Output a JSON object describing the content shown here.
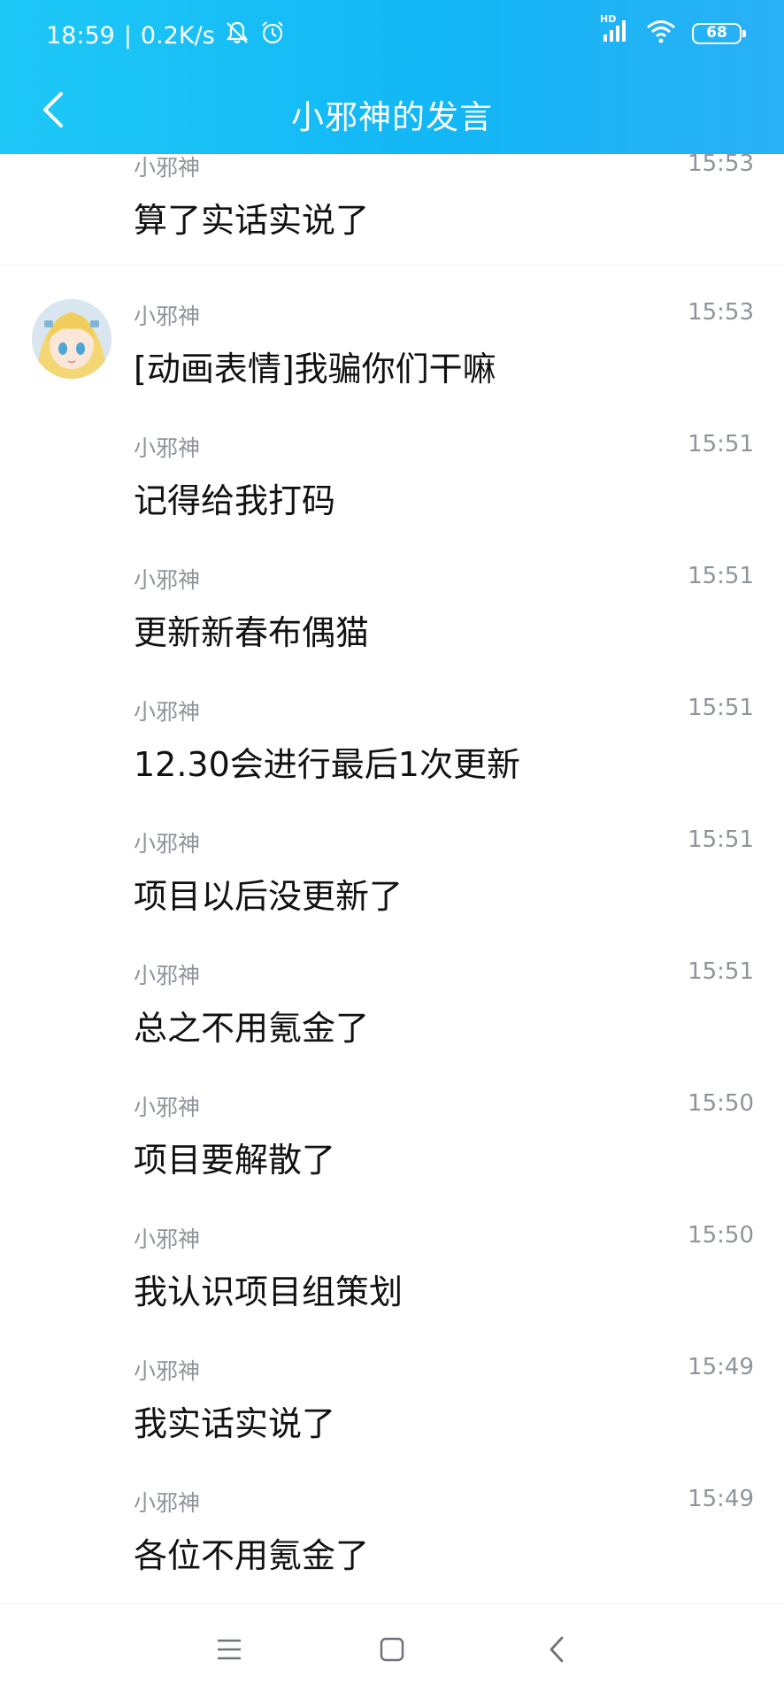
{
  "status_bar": {
    "time": "18:59",
    "separator": "|",
    "net_speed": "0.2K/s",
    "hd_label": "HD",
    "battery_level": "68"
  },
  "header": {
    "title": "小邪神的发言"
  },
  "messages": [
    {
      "sender": "小邪神",
      "time": "15:53",
      "text": "算了实话实说了"
    },
    {
      "sender": "小邪神",
      "time": "15:53",
      "text": "[动画表情]我骗你们干嘛"
    },
    {
      "sender": "小邪神",
      "time": "15:51",
      "text": "记得给我打码"
    },
    {
      "sender": "小邪神",
      "time": "15:51",
      "text": "更新新春布偶猫"
    },
    {
      "sender": "小邪神",
      "time": "15:51",
      "text": "12.30会进行最后1次更新"
    },
    {
      "sender": "小邪神",
      "time": "15:51",
      "text": "项目以后没更新了"
    },
    {
      "sender": "小邪神",
      "time": "15:51",
      "text": "总之不用氪金了"
    },
    {
      "sender": "小邪神",
      "time": "15:50",
      "text": "项目要解散了"
    },
    {
      "sender": "小邪神",
      "time": "15:50",
      "text": "我认识项目组策划"
    },
    {
      "sender": "小邪神",
      "time": "15:49",
      "text": "我实话实说了"
    },
    {
      "sender": "小邪神",
      "time": "15:49",
      "text": "各位不用氪金了"
    }
  ],
  "icons": {
    "back": "back-arrow-icon",
    "mute": "bell-off-icon",
    "alarm": "alarm-clock-icon",
    "signal": "signal-icon",
    "wifi": "wifi-icon",
    "battery": "battery-icon",
    "menu": "menu-icon",
    "home": "home-square-icon",
    "nav_back": "nav-back-icon"
  },
  "colors": {
    "accent": "#12b7f5",
    "text_primary": "#111111",
    "text_secondary": "#8f949b"
  }
}
